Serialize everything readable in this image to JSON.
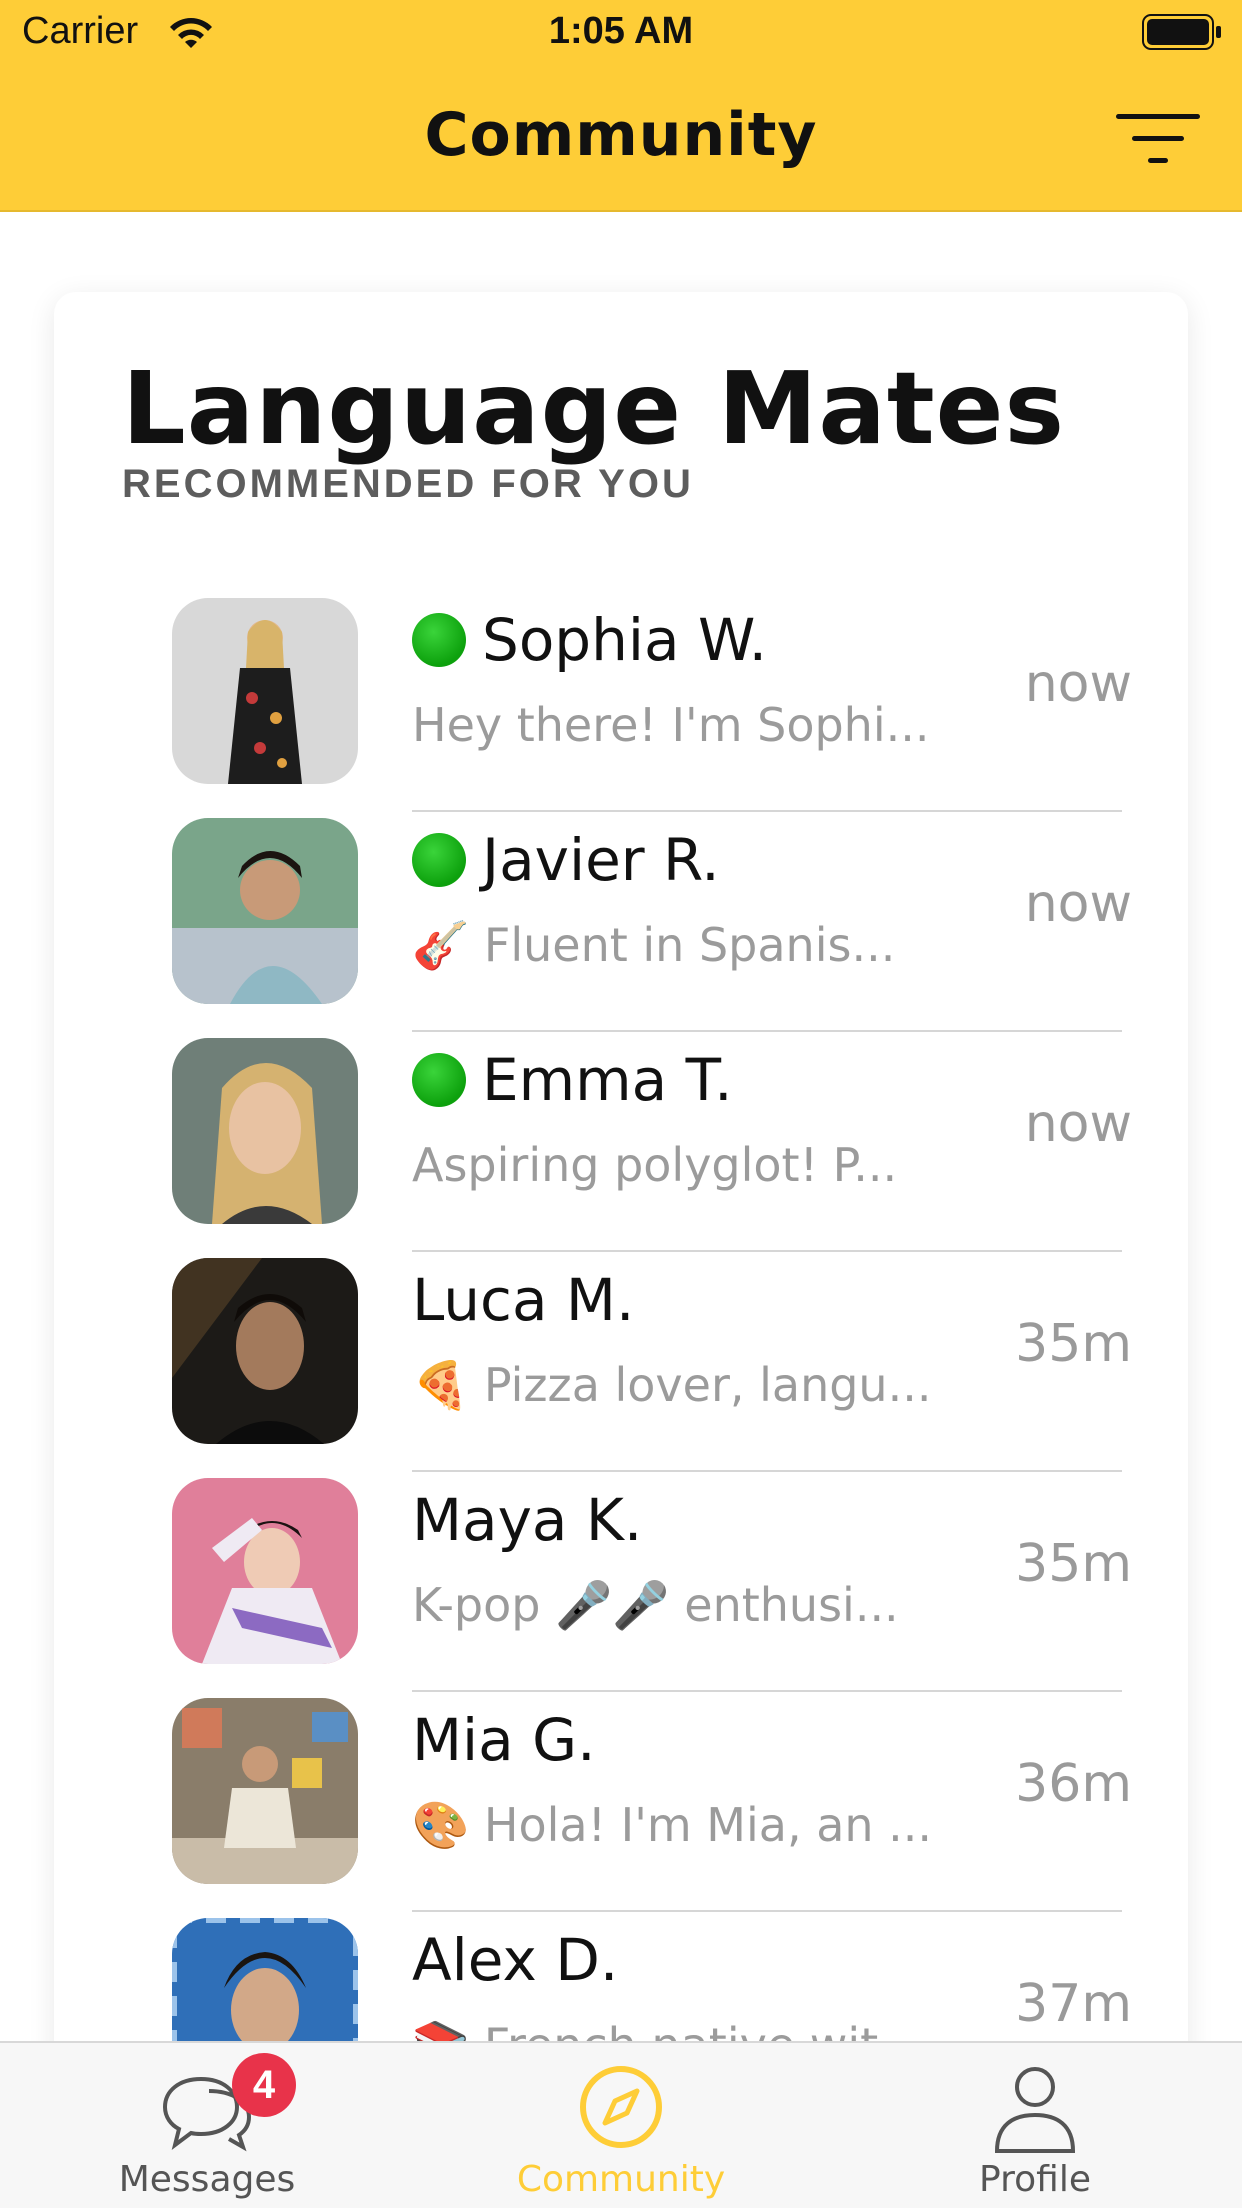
{
  "status_bar": {
    "carrier": "Carrier",
    "time": "1:05 AM"
  },
  "nav": {
    "title": "Community"
  },
  "section": {
    "title": "Language Mates",
    "subtitle": "RECOMMENDED FOR YOU"
  },
  "users": [
    {
      "name": "Sophia W.",
      "online": true,
      "preview": "Hey there! I'm Sophi...",
      "time": "now"
    },
    {
      "name": "Javier R.",
      "online": true,
      "preview": "🎸 Fluent in Spanis...",
      "time": "now"
    },
    {
      "name": "Emma T.",
      "online": true,
      "preview": "Aspiring polyglot! P...",
      "time": "now"
    },
    {
      "name": "Luca M.",
      "online": false,
      "preview": "🍕 Pizza lover, langu...",
      "time": "35m"
    },
    {
      "name": "Maya K.",
      "online": false,
      "preview": "K-pop 🎤🎤 enthusi...",
      "time": "35m"
    },
    {
      "name": "Mia G.",
      "online": false,
      "preview": "🎨 Hola! I'm Mia, an ...",
      "time": "36m"
    },
    {
      "name": "Alex D.",
      "online": false,
      "preview": "📚 French native wit...",
      "time": "37m"
    }
  ],
  "tabs": [
    {
      "label": "Messages",
      "icon": "chat-bubbles-icon",
      "badge": "4"
    },
    {
      "label": "Community",
      "icon": "compass-icon",
      "active": true
    },
    {
      "label": "Profile",
      "icon": "person-icon"
    }
  ],
  "colors": {
    "accent": "#fecd37",
    "badge": "#e8334a",
    "online": "#14b314"
  }
}
